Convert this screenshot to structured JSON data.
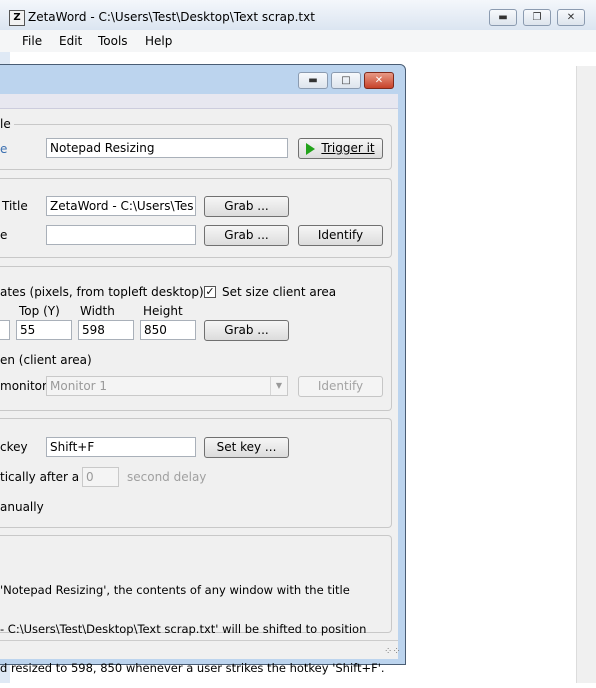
{
  "main_window": {
    "title": "ZetaWord - C:\\Users\\Test\\Desktop\\Text scrap.txt",
    "icon_letter": "Z",
    "menu": [
      "File",
      "Edit",
      "Tools",
      "Help"
    ]
  },
  "dialog": {
    "rule_group": {
      "legend": "le",
      "name_label": "e",
      "name_value": "Notepad Resizing",
      "trigger_button": "Trigger it"
    },
    "window_group": {
      "title_label": "Title",
      "title_value": "ZetaWord - C:\\Users\\Tes",
      "title_grab_button": "Grab ...",
      "class_label": "e",
      "class_value": "",
      "class_grab_button": "Grab ...",
      "identify_button": "Identify"
    },
    "coords_group": {
      "heading": "ates (pixels, from topleft desktop)",
      "set_size_client_area_label": "Set size client area",
      "set_size_client_area_checked": true,
      "left_value": "",
      "top_label": "Top (Y)",
      "top_value": "55",
      "width_label": "Width",
      "width_value": "598",
      "height_label": "Height",
      "height_value": "850",
      "grab_button": "Grab ...",
      "screen_label": "en (client area)",
      "monitor_label": "monitor",
      "monitor_value": "Monitor 1",
      "monitor_identify_button": "Identify"
    },
    "hotkey_group": {
      "hotkey_label": "ckey",
      "hotkey_value": "Shift+F",
      "set_key_button": "Set key ...",
      "auto_label": "tically after a",
      "delay_value": "0",
      "delay_label": "second delay",
      "manual_label": "anually"
    },
    "summary": {
      "line1": "'Notepad Resizing', the contents of any window with the title",
      "line2": "- C:\\Users\\Test\\Desktop\\Text scrap.txt' will be shifted to position",
      "line3": "d resized to 598, 850 whenever a user strikes the hotkey 'Shift+F'."
    }
  }
}
